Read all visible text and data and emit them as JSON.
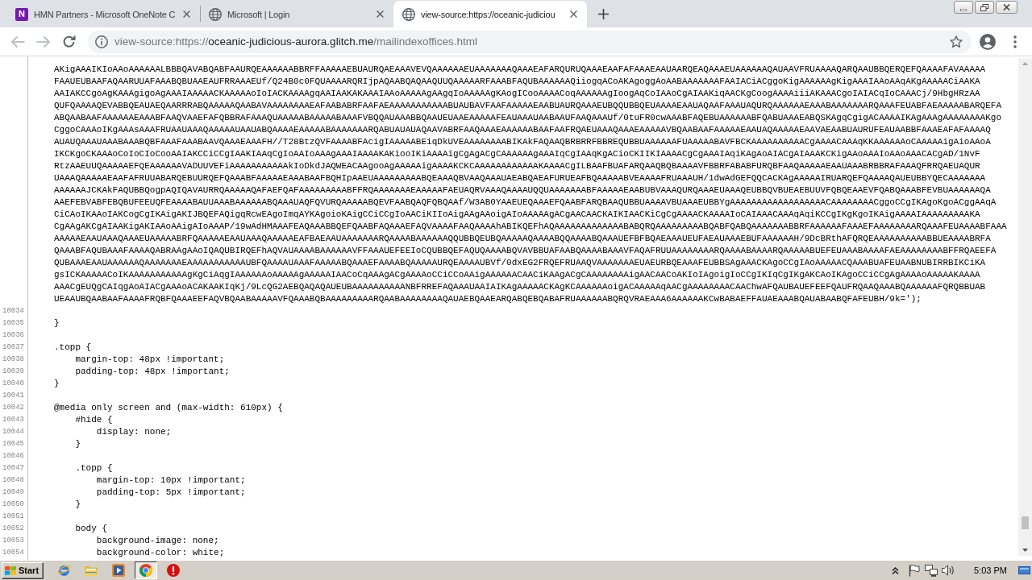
{
  "tabs": [
    {
      "kind": "note",
      "logo_text": "N",
      "title": "HMN Partners - Microsoft OneNote C",
      "selected": false
    },
    {
      "kind": "web",
      "title": "Microsoft | Login",
      "selected": false
    },
    {
      "kind": "web",
      "title": "view-source:https://oceanic-judiciou",
      "selected": true
    }
  ],
  "toolbar": {
    "buttons": [
      {
        "kind": "back",
        "disabled": true
      },
      {
        "kind": "forward",
        "disabled": true
      },
      {
        "kind": "reload",
        "disabled": false
      }
    ]
  },
  "address": {
    "scheme": "view-source:https://",
    "host": "oceanic-judicious-aurora.glitch.me",
    "path": "/mailindexoffices.html"
  },
  "source": {
    "wrapped_rows": [
      "AKigAAAIKIoAAoAAAAAALBBBQAVABQABFAAURQEAAAAAABBRFFAAAAAEBUAURQAEAAAVEVQAAAAAAEUAAAAAAAQAAAEAFARQURUQAAAEAAFAFAAAEAAUAARQEAQAAAEUAAAAAAQAUAAVFRUAAAAQARQAAUBBQERQEFQAAAAFAVAAAAA",
      "FAAUEUBAAFAQAARUUAFAAABQBUAAEAUFRRAAAEUf/Q24B0c0FQUAAAARQRIjpAQAABQAQAAQUUQAAAAARFAAABFAQUBAAAAAAQiiogqACoAKAgoggAoAABAAAAAAAFAAIACiACggoKigAAAAAAgKigAAAIAAoAAqAKgAAAAACiAAKA",
      "AAIAKCCgoAgKAAAgigoAgAAAIAAAAACKAAAAAoIoIACKAAAAgqAAIAAKAKAAAIAAoAAAAAgAAgqIoAAAAAgKAogICooAAAACoqAAAAAAgIoogAqCoIAAoCgAIAAKiqAACKgCoogAAAAiiiAKAAACgoIAIACqIoCAAACj/9HbgHRzAA",
      "QUFQAAAAQEVABBQEAUAEQAARRRABQAAAAAQAABAVAAAAAAAAEAFAABABRFAAFAEAAAAAAAAAAABUAUBAVFAAFAAAAAEAABUAURQAAAEUBQQUBBQEUAAAAEAAUAQAAFAAAUAQURQAAAAAAEAAABAAAAAAARQAAAFEUABFAEAAAAABARQEFA",
      "ABQAABAAFAAAAAAEAAABFAAQVAAEFAFQBBRAFAAAQUAAAAABAAAAABAAAFVBQQAUAAABBQAAUEUAAEAAAAAFEAUAAAUAABAAUFAAQAAAUf/0tuFR0cwAAABFAQEBUAAAAAABFQABUAAAEABQSKAgqCgigACAAAAIKAgAAAgAAAAAAAAKgo",
      "CggoCAAAoIKgAAAsAAAFRUAAUAAAQAAAAAUAAUABQAAAAEAAAAABAAAAAAARQABUAUAUAQAAVABRFAAQAAAEAAAAAABAAFAAFRQAEUAAAQAAAEAAAAAVBQAABAAFAAAAAEAAUAQAAAAAEAAVAEAABUAURUFEAUAABBFAAAEAFAFAAAAQ",
      "AUAUQAAAUAAABAAABQBFAAAFAAABAAVQAAAEAAAFH//T28BtzQVFAAAABFAcigIAAAAABEiqDkUVEAAAAAAAABIKAkFAQAAQBRBRRFBBREQUBBUAAAAAAFUAAAAABAVFBCKAAAAAAAAAACgAAAACAAAqKKAAAAAAoCAAAAAigAioAAoA",
      "IKCKgoCKAAAoCoIoCIoCooAAIAKCCiCCgIAAKIAAqCgIoAAIoAAAgAAAIAAAAKAKiooIKiAAAAigCgAgACgCAAAAAAgAAAIqCgIAAqKgACioCKIIKIAAAACgCgAAAIAqiKAgAoAIACgAIAAAKCKigAAoAAAIoAAoAAACACgAD/1NvF",
      "RtzAAEUUQAAAAAEFQEAAAAAAVADUUVEFiAAAAAAAAAAAkIoDkdJAQWEACAAgooAgAAAAAigAAAAKCKCAAAAAAAAAAAAKAAAACgILBAAFBUAFARQAAQBQBAAAAVFBBRFABABFURQBFAAQAAAAAEAAUAAABRBBRAFAAAQFRRQAEUAQUR",
      "UAAAQAAAAAEAAFAFRUUABARQEBUURQEFQAAABFAAAAAEAAABAAFBQHIpAAEUAAAAAAAAABQEAAAQBVAAQAAAUAEABQAEAFURUEAFBQAAAAABVEAAAAFRUAAAUH/1dwAdGEFQQCACKAgAAAAAIRUARQEFQAAAAQAUEUBBYQECAAAAAAA",
      "AAAAAAJCKAkFAQUBBQogpAQIQAVAURRQAAAAAQAFAEFQAFAAAAAAAAABFFRQAAAAAAAEAAAAAFAEUAQRVAAAQAAAAUQQUAAAAAAABFAAAAAEAABUBVAAAQURQAAAEUAAAQEUBBQVBUEAEBUUVFQBQEAAEVFQABQAAABFEVBUAAAAAAQA",
      "AAEFEBVABFEBQBUFEEUQFEAAAABAUUAAABAAAAAABQAAAUAQFQVURQAAAAABQEVFAABQAQFQBQAAf/W3AB0YAAEUEQAAAEFQAABFARQBAAQUBBUAAAAVBUAAAEUBBYgAAAAAAAAAAAAAAAAAACAAAAAAAACggoCCgIKAgoKgoACggAAqA",
      "CiCAoIKAAoIAKCogCgIKAigAKIJBQEFAQigqRcwEAgoImqAYKAgoioKAigCCiCCgIoAACiKIIoAigAAgAAoigAIoAAAAAgACgAACAACKAIKIAACKiCgCgAAAACKAAAAIoCAIAAACAAAqAqiKCCgIKgKgoIKAigAAAAIAAAAAAAAAKA",
      "CgAAgAKCgAIAAKigAKIAAoAAigAIoAAAP/19wAdHMAAAFEAQAAABBQEFQAABFAQAAAEFAQVAAAAFAAQAAAAhABIKQEFhAQAAAAAAAAAAAAABABQRQAAAAAAAAABQABFQABQAAAAAAABBRFAAAAAAFAAAEFAAAAAAAARQAAAFEUAAAABFAAA",
      "AAAAAEAAUAAAQAAAEUAAAAABRFQAAAAAEAAUAAAQAAAAAEAFBAEAAUAAAAAAARQAAAABAAAAAAQQUBBQEUBQAAAAAQAAAABQQAAAABQAAAUEFBFBQAEAAAUEUFAEAUAAAEBUFAAAAAAH/9DcBRthAFQRQEAAAAAAAAAABBUEAAAABRFA",
      "QAAABFAQUBAAAFAAAAQABRAAgAAoIQAQUBIRQEFhAQVAUAAAABAAAAAAVFFAAAUEFEEIoCQUBBQEFAQUQAAAABQVAVBBUAFAABQAAAABAAAVFAQAFRUUAAAAAAAARQAAAABAAAARQAAAAABUEFEUAAABAAAAFAEAAAAAAAABFFRQAEEFA",
      "QUBAAAEAAUAAAAAAQAAAAAAAEAAAAAAAAAAAUBFQAAAAUAAAFAAAAABQAAAEFAAAABQAAAAAURQEAAAAUBVf/0dxEG2FRQEFRUAAQVAAAAAAAEUAEURBQEAAAFEUBBSAgAAACKAgoCCgIAoAAAAACQAAABUAFEUAABNUBIRRBIKCiKA",
      "gsICKAAAAACoIKAAAAAAAAAAAgKgCiAqgIAAAAAAoAAAAAgAAAAAIAACoCqAAAgACgAAAAoCCiCCoAAigAAAAAACAACiKAAgACgCAAAAAAAAigAACAACoAKIoIAgoigIoCCgIKIqCgIKgAKCAoIKAgoCCiCCgAgAAAAoAAAAAKAAAA",
      "AAACgEUQgCAIqgAoAIACgAAAoACAKAAKIqKj/9LcQG2AEBQAQAQAUEUBAAAAAAAAAANBFRREFAQAAAUAAIAIKAgAAAAACKAgKCAAAAAAoigACAAAAAqAACgAAAAAAAACAAChwAFQAUBAUEFEEFQAUFRQAAQAAABQAAAAAAFQRQBBUAB",
      "UEAAUBQAABAAFAAAAFRQBFQAAAEEFAQVBQAABAAAAAVFQAAABQBAAAAAAAAARQAABAAAAAAAAQAUAEBQAAEARQABQEBQABAFRUAAAAAABQRQVRAEAAA6AAAAAAKCwBABAEFFAUAEAAABQAUABAABQFAFEUBH/9k=');"
    ],
    "lines": [
      {
        "number": "10034"
      },
      {
        "number": "10035",
        "text": "}"
      },
      {
        "number": "10036"
      },
      {
        "number": "10037",
        "text": ".topp {"
      },
      {
        "number": "10038",
        "text": "    margin-top: 48px !important;"
      },
      {
        "number": "10039",
        "text": "    padding-top: 48px !important;"
      },
      {
        "number": "10040",
        "text": "}"
      },
      {
        "number": "10041"
      },
      {
        "number": "10042",
        "text": "@media only screen and (max-width: 610px) {"
      },
      {
        "number": "10043",
        "text": "    #hide {"
      },
      {
        "number": "10044",
        "text": "        display: none;"
      },
      {
        "number": "10045",
        "text": "    }"
      },
      {
        "number": "10046"
      },
      {
        "number": "10047",
        "text": "    .topp {"
      },
      {
        "number": "10048",
        "text": "        margin-top: 10px !important;"
      },
      {
        "number": "10049",
        "text": "        padding-top: 5px !important;"
      },
      {
        "number": "10050",
        "text": "    }"
      },
      {
        "number": "10051"
      },
      {
        "number": "10052",
        "text": "    body {"
      },
      {
        "number": "10053",
        "text": "        background-image: none;"
      },
      {
        "number": "10054",
        "text": "        background-color: white;"
      }
    ]
  },
  "taskbar": {
    "start": "Start",
    "buttons": [
      {
        "kind": "globe",
        "selected": false
      },
      {
        "kind": "folder",
        "selected": false
      },
      {
        "kind": "player",
        "selected": false
      },
      {
        "kind": "browser",
        "selected": true
      },
      {
        "kind": "alert",
        "selected": false
      }
    ],
    "clock": "5:03 PM"
  }
}
